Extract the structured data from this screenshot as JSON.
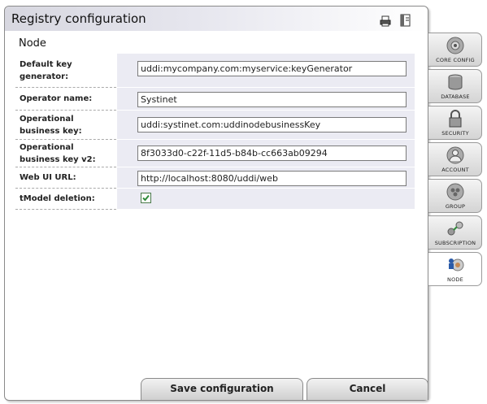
{
  "window": {
    "title": "Registry configuration"
  },
  "toolbar": {
    "print_icon": "print-icon",
    "export_icon": "export-icon"
  },
  "section": {
    "title": "Node"
  },
  "fields": [
    {
      "label": "Default key generator:",
      "value": "uddi:mycompany.com:myservice:keyGenerator"
    },
    {
      "label": "Operator name:",
      "value": "Systinet"
    },
    {
      "label": "Operational business key:",
      "value": "uddi:systinet.com:uddinodebusinessKey"
    },
    {
      "label": "Operational business key v2:",
      "value": "8f3033d0-c22f-11d5-b84b-cc663ab09294"
    },
    {
      "label": "Web UI URL:",
      "value": "http://localhost:8080/uddi/web"
    }
  ],
  "tmodel": {
    "label": "tModel deletion:",
    "checked": true
  },
  "buttons": {
    "save": "Save configuration",
    "cancel": "Cancel"
  },
  "tabs": [
    {
      "label": "CORE CONFIG",
      "icon": "core-config-icon"
    },
    {
      "label": "DATABASE",
      "icon": "database-icon"
    },
    {
      "label": "SECURITY",
      "icon": "security-icon"
    },
    {
      "label": "ACCOUNT",
      "icon": "account-icon"
    },
    {
      "label": "GROUP",
      "icon": "group-icon"
    },
    {
      "label": "SUBSCRIPTION",
      "icon": "subscription-icon"
    },
    {
      "label": "NODE",
      "icon": "node-icon",
      "active": true
    }
  ],
  "colors": {
    "field_bg": "#ebebf3",
    "title_gradient_start": "#d7d7e0",
    "checkbox_mark": "#2e8b3a"
  }
}
